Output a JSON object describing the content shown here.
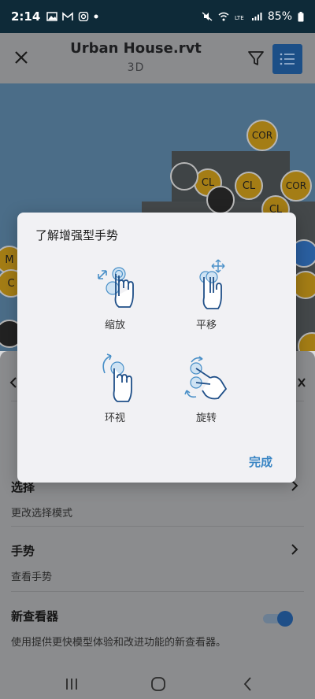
{
  "status_bar": {
    "time": "2:14",
    "battery": "85%"
  },
  "header": {
    "title": "Urban House.rvt",
    "subtitle": "3D"
  },
  "viewport_tags": {
    "cor1": "COR",
    "cor2": "COR",
    "cl1": "CL",
    "cl2": "CL",
    "cl3": "CL",
    "m": "M",
    "c": "C"
  },
  "sheet": {
    "select_title": "选择",
    "select_desc": "更改选择模式",
    "gesture_title": "手势",
    "gesture_desc": "查看手势",
    "viewer_title": "新查看器",
    "viewer_desc": "使用提供更快模型体验和改进功能的新查看器。",
    "viewer_enabled": true
  },
  "dialog": {
    "title": "了解增强型手势",
    "gestures": [
      {
        "label": "缩放",
        "icon": "pinch-zoom-icon"
      },
      {
        "label": "平移",
        "icon": "two-finger-pan-icon"
      },
      {
        "label": "环视",
        "icon": "look-around-icon"
      },
      {
        "label": "旋转",
        "icon": "rotate-icon"
      }
    ],
    "done_label": "完成"
  },
  "colors": {
    "accent": "#1c4f87",
    "link": "#3b86c4",
    "gesture_blue": "#4a90c8"
  }
}
